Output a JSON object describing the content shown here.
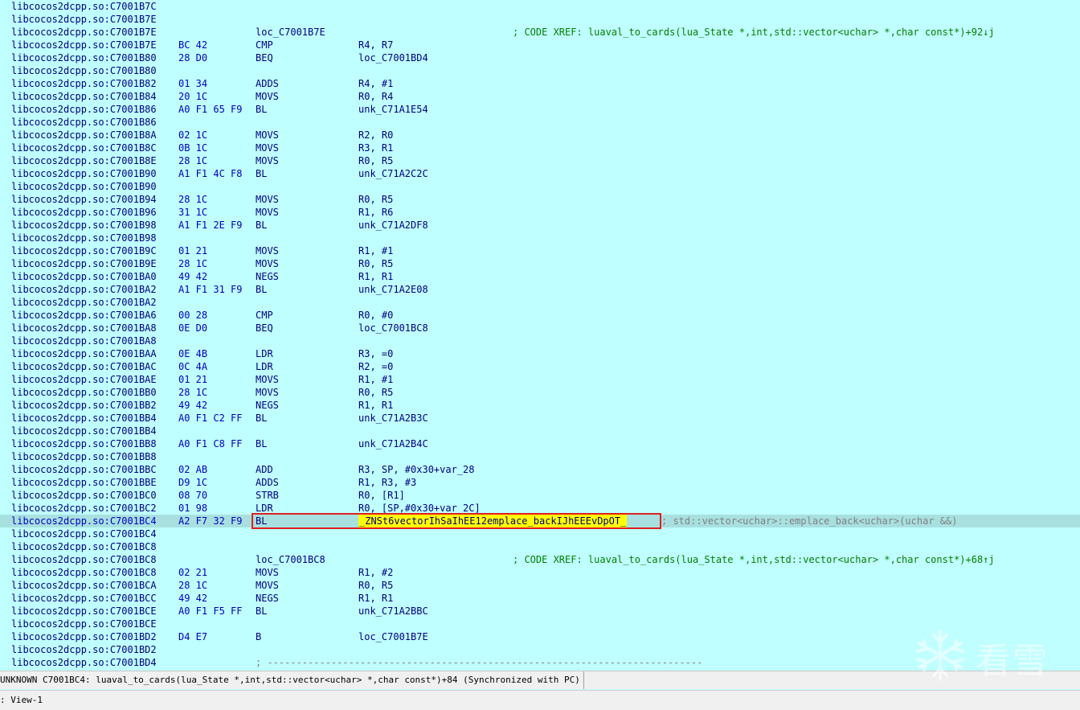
{
  "listing": [
    {
      "addr": "libcocos2dcpp.so:C7001B7C"
    },
    {
      "addr": "libcocos2dcpp.so:C7001B7E"
    },
    {
      "addr": "libcocos2dcpp.so:C7001B7E",
      "label": "loc_C7001B7E",
      "xref": "; CODE XREF: luaval_to_cards(lua_State *,int,std::vector<uchar> *,char const*)+92↓j"
    },
    {
      "addr": "libcocos2dcpp.so:C7001B7E",
      "bytes": "BC 42",
      "mnem": "CMP",
      "ops": "R4, R7"
    },
    {
      "addr": "libcocos2dcpp.so:C7001B80",
      "bytes": "28 D0",
      "mnem": "BEQ",
      "ops": "loc_C7001BD4"
    },
    {
      "addr": "libcocos2dcpp.so:C7001B80"
    },
    {
      "addr": "libcocos2dcpp.so:C7001B82",
      "bytes": "01 34",
      "mnem": "ADDS",
      "ops": "R4, #1"
    },
    {
      "addr": "libcocos2dcpp.so:C7001B84",
      "bytes": "20 1C",
      "mnem": "MOVS",
      "ops": "R0, R4"
    },
    {
      "addr": "libcocos2dcpp.so:C7001B86",
      "bytes": "A0 F1 65 F9",
      "mnem": "BL",
      "ops": "unk_C71A1E54"
    },
    {
      "addr": "libcocos2dcpp.so:C7001B86"
    },
    {
      "addr": "libcocos2dcpp.so:C7001B8A",
      "bytes": "02 1C",
      "mnem": "MOVS",
      "ops": "R2, R0"
    },
    {
      "addr": "libcocos2dcpp.so:C7001B8C",
      "bytes": "0B 1C",
      "mnem": "MOVS",
      "ops": "R3, R1"
    },
    {
      "addr": "libcocos2dcpp.so:C7001B8E",
      "bytes": "28 1C",
      "mnem": "MOVS",
      "ops": "R0, R5"
    },
    {
      "addr": "libcocos2dcpp.so:C7001B90",
      "bytes": "A1 F1 4C F8",
      "mnem": "BL",
      "ops": "unk_C71A2C2C"
    },
    {
      "addr": "libcocos2dcpp.so:C7001B90"
    },
    {
      "addr": "libcocos2dcpp.so:C7001B94",
      "bytes": "28 1C",
      "mnem": "MOVS",
      "ops": "R0, R5"
    },
    {
      "addr": "libcocos2dcpp.so:C7001B96",
      "bytes": "31 1C",
      "mnem": "MOVS",
      "ops": "R1, R6"
    },
    {
      "addr": "libcocos2dcpp.so:C7001B98",
      "bytes": "A1 F1 2E F9",
      "mnem": "BL",
      "ops": "unk_C71A2DF8"
    },
    {
      "addr": "libcocos2dcpp.so:C7001B98"
    },
    {
      "addr": "libcocos2dcpp.so:C7001B9C",
      "bytes": "01 21",
      "mnem": "MOVS",
      "ops": "R1, #1"
    },
    {
      "addr": "libcocos2dcpp.so:C7001B9E",
      "bytes": "28 1C",
      "mnem": "MOVS",
      "ops": "R0, R5"
    },
    {
      "addr": "libcocos2dcpp.so:C7001BA0",
      "bytes": "49 42",
      "mnem": "NEGS",
      "ops": "R1, R1"
    },
    {
      "addr": "libcocos2dcpp.so:C7001BA2",
      "bytes": "A1 F1 31 F9",
      "mnem": "BL",
      "ops": "unk_C71A2E08"
    },
    {
      "addr": "libcocos2dcpp.so:C7001BA2"
    },
    {
      "addr": "libcocos2dcpp.so:C7001BA6",
      "bytes": "00 28",
      "mnem": "CMP",
      "ops": "R0, #0"
    },
    {
      "addr": "libcocos2dcpp.so:C7001BA8",
      "bytes": "0E D0",
      "mnem": "BEQ",
      "ops": "loc_C7001BC8"
    },
    {
      "addr": "libcocos2dcpp.so:C7001BA8"
    },
    {
      "addr": "libcocos2dcpp.so:C7001BAA",
      "bytes": "0E 4B",
      "mnem": "LDR",
      "ops": "R3, =0"
    },
    {
      "addr": "libcocos2dcpp.so:C7001BAC",
      "bytes": "0C 4A",
      "mnem": "LDR",
      "ops": "R2, =0"
    },
    {
      "addr": "libcocos2dcpp.so:C7001BAE",
      "bytes": "01 21",
      "mnem": "MOVS",
      "ops": "R1, #1"
    },
    {
      "addr": "libcocos2dcpp.so:C7001BB0",
      "bytes": "28 1C",
      "mnem": "MOVS",
      "ops": "R0, R5"
    },
    {
      "addr": "libcocos2dcpp.so:C7001BB2",
      "bytes": "49 42",
      "mnem": "NEGS",
      "ops": "R1, R1"
    },
    {
      "addr": "libcocos2dcpp.so:C7001BB4",
      "bytes": "A0 F1 C2 FF",
      "mnem": "BL",
      "ops": "unk_C71A2B3C"
    },
    {
      "addr": "libcocos2dcpp.so:C7001BB4"
    },
    {
      "addr": "libcocos2dcpp.so:C7001BB8",
      "bytes": "A0 F1 C8 FF",
      "mnem": "BL",
      "ops": "unk_C71A2B4C"
    },
    {
      "addr": "libcocos2dcpp.so:C7001BB8"
    },
    {
      "addr": "libcocos2dcpp.so:C7001BBC",
      "bytes": "02 AB",
      "mnem": "ADD",
      "ops": "R3, SP, #0x30+var_28"
    },
    {
      "addr": "libcocos2dcpp.so:C7001BBE",
      "bytes": "D9 1C",
      "mnem": "ADDS",
      "ops": "R1, R3, #3"
    },
    {
      "addr": "libcocos2dcpp.so:C7001BC0",
      "bytes": "08 70",
      "mnem": "STRB",
      "ops": "R0, [R1]"
    },
    {
      "addr": "libcocos2dcpp.so:C7001BC2",
      "bytes": "01 98",
      "mnem": "LDR",
      "ops": "R0, [SP,#0x30+var_2C]"
    },
    {
      "addr": "libcocos2dcpp.so:C7001BC4",
      "bytes": "A2 F7 32 F9",
      "mnem": "BL",
      "ops": "_ZNSt6vectorIhSaIhEE12emplace_backIJhEEEvDpOT_",
      "cmt": "; std::vector<uchar>::emplace_back<uchar>(uchar &&)",
      "current": true
    },
    {
      "addr": "libcocos2dcpp.so:C7001BC4"
    },
    {
      "addr": "libcocos2dcpp.so:C7001BC8"
    },
    {
      "addr": "libcocos2dcpp.so:C7001BC8",
      "label": "loc_C7001BC8",
      "xref": "; CODE XREF: luaval_to_cards(lua_State *,int,std::vector<uchar> *,char const*)+68↑j"
    },
    {
      "addr": "libcocos2dcpp.so:C7001BC8",
      "bytes": "02 21",
      "mnem": "MOVS",
      "ops": "R1, #2"
    },
    {
      "addr": "libcocos2dcpp.so:C7001BCA",
      "bytes": "28 1C",
      "mnem": "MOVS",
      "ops": "R0, R5"
    },
    {
      "addr": "libcocos2dcpp.so:C7001BCC",
      "bytes": "49 42",
      "mnem": "NEGS",
      "ops": "R1, R1"
    },
    {
      "addr": "libcocos2dcpp.so:C7001BCE",
      "bytes": "A0 F1 F5 FF",
      "mnem": "BL",
      "ops": "unk_C71A2BBC"
    },
    {
      "addr": "libcocos2dcpp.so:C7001BCE"
    },
    {
      "addr": "libcocos2dcpp.so:C7001BD2",
      "bytes": "D4 E7",
      "mnem": "B",
      "ops": "loc_C7001B7E"
    },
    {
      "addr": "libcocos2dcpp.so:C7001BD2"
    },
    {
      "addr": "libcocos2dcpp.so:C7001BD4",
      "sep": "; ---------------------------------------------------------------------------"
    }
  ],
  "status": {
    "text": "UNKNOWN C7001BC4: luaval_to_cards(lua_State *,int,std::vector<uchar> *,char const*)+84 (Synchronized with PC)"
  },
  "bottom": {
    "view_tab": ": View-1"
  },
  "watermark": {
    "text": "看雪"
  },
  "colors": {
    "background": "#c0ffff",
    "address": "#000080",
    "bytes": "#0000c0",
    "xref": "#008000",
    "comment": "#808080",
    "current_line": "#a8e0e0",
    "highlight": "#ffff00",
    "box": "#e02020"
  }
}
